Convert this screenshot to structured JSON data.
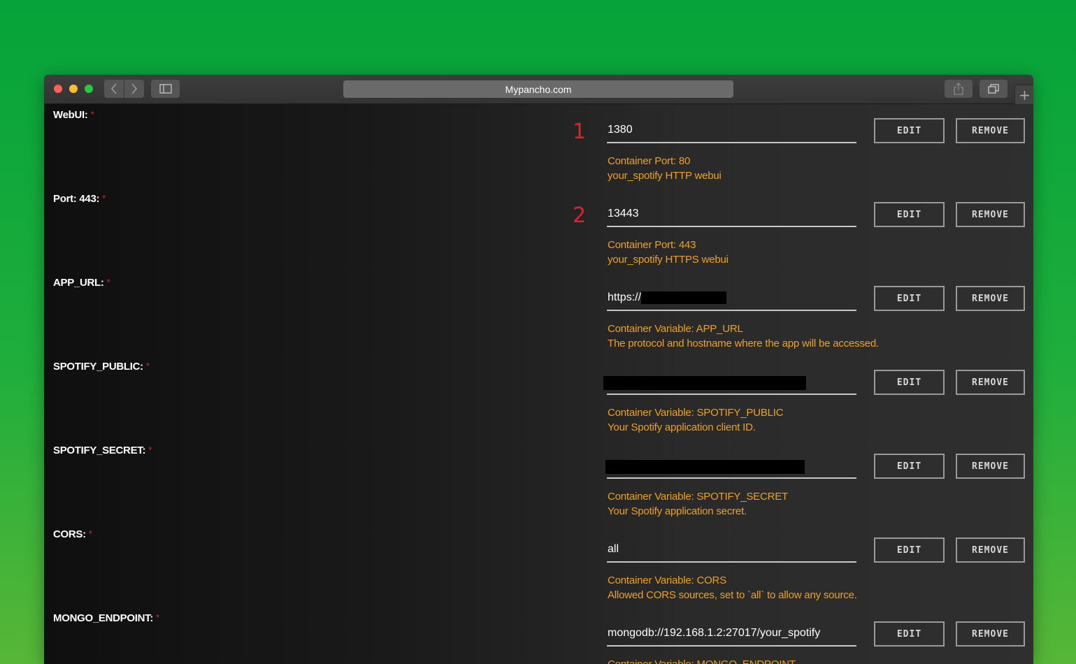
{
  "browser": {
    "url": "Mypancho.com",
    "new_tab": "+"
  },
  "rows": [
    {
      "label": "WebUI:",
      "required": "*",
      "marker": "1",
      "value": "1380",
      "desc1": "Container Port: 80",
      "desc2": "your_spotify HTTP webui"
    },
    {
      "label": "Port: 443:",
      "required": "*",
      "marker": "2",
      "value": "13443",
      "desc1": "Container Port: 443",
      "desc2": "your_spotify HTTPS webui"
    },
    {
      "label": "APP_URL:",
      "required": "*",
      "value": "https://",
      "desc1": "Container Variable: APP_URL",
      "desc2": "The protocol and hostname where the app will be accessed."
    },
    {
      "label": "SPOTIFY_PUBLIC:",
      "required": "*",
      "value": "",
      "desc1": "Container Variable: SPOTIFY_PUBLIC",
      "desc2": "Your Spotify application client ID."
    },
    {
      "label": "SPOTIFY_SECRET:",
      "required": "*",
      "value": "",
      "desc1": "Container Variable: SPOTIFY_SECRET",
      "desc2": "Your Spotify application secret."
    },
    {
      "label": "CORS:",
      "required": "*",
      "value": "all",
      "desc1": "Container Variable: CORS",
      "desc2": "Allowed CORS sources, set to `all` to allow any source."
    },
    {
      "label": "MONGO_ENDPOINT:",
      "required": "*",
      "value": "mongodb://192.168.1.2:27017/your_spotify",
      "desc1": "Container Variable: MONGO_ENDPOINT",
      "desc2": ""
    }
  ],
  "buttons": {
    "edit": "EDIT",
    "remove": "REMOVE"
  },
  "colors": {
    "description": "#f2a11a",
    "marker": "#e0202a",
    "required": "#e0202a"
  }
}
